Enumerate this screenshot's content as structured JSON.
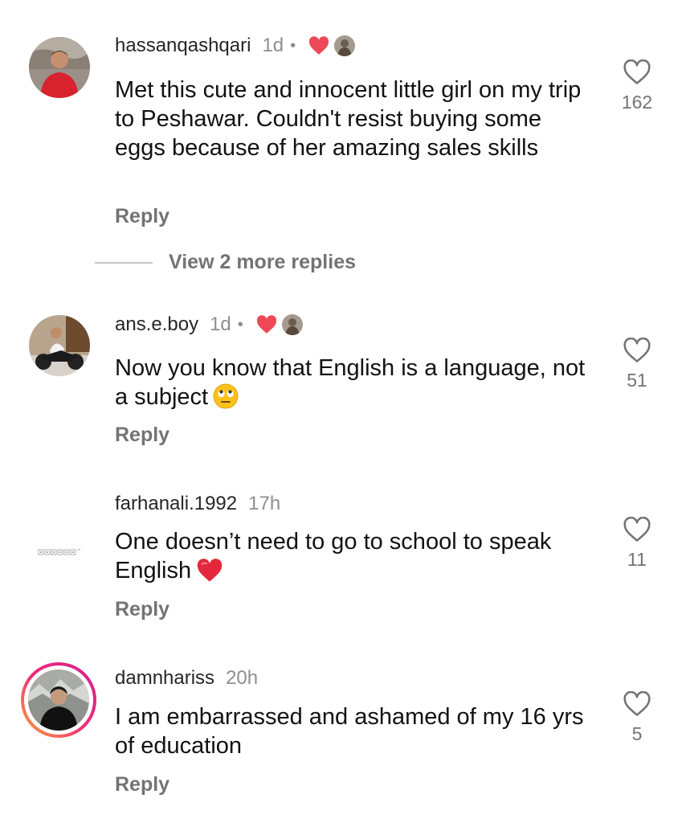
{
  "colors": {
    "like_red": "#ed4956",
    "text": "#121212",
    "muted": "#737373",
    "story_ring_start": "#f9a23a",
    "story_ring_end": "#d3248f"
  },
  "comments": [
    {
      "username": "hassanqashqari",
      "time": "1d",
      "separator": "•",
      "creator_liked": true,
      "text": "Met this cute and innocent little girl on my trip to Peshawar. Couldn't resist buying some eggs because of her amazing sales skills",
      "reply_label": "Reply",
      "like_count": "162",
      "like_icon": "heart-outline-icon"
    },
    {
      "username": "ans.e.boy",
      "time": "1d",
      "separator": "•",
      "creator_liked": true,
      "text": "Now you know that English is a language, not a subject",
      "emoji": "face-with-rolling-eyes",
      "reply_label": "Reply",
      "like_count": "51",
      "like_icon": "heart-outline-icon"
    },
    {
      "username": "farhanali.1992",
      "time": "17h",
      "creator_liked": false,
      "text": "One doesn’t need to go to school to speak English",
      "emoji": "red-heart",
      "reply_label": "Reply",
      "like_count": "11",
      "like_icon": "heart-outline-icon"
    },
    {
      "username": "damnhariss",
      "time": "20h",
      "creator_liked": false,
      "has_story_ring": true,
      "text": "I am embarrassed and ashamed of my 16 yrs of education",
      "reply_label": "Reply",
      "like_count": "5",
      "like_icon": "heart-outline-icon"
    }
  ],
  "view_replies_label": "View 2 more replies"
}
